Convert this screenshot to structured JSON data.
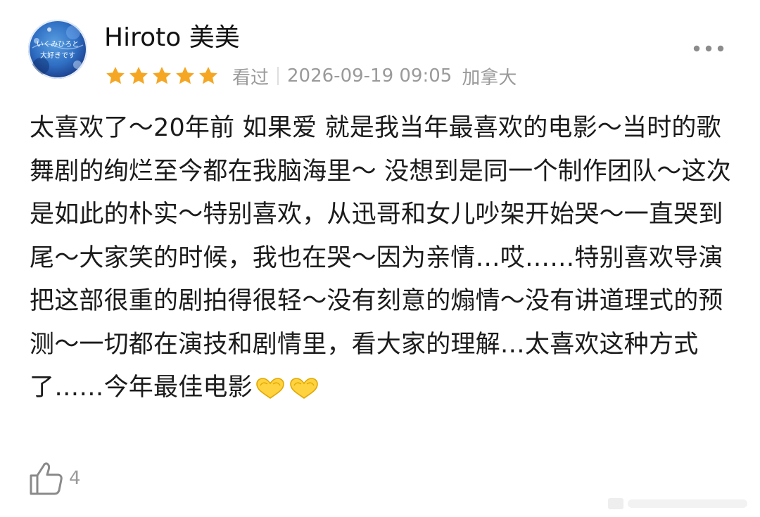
{
  "review": {
    "user": {
      "name": "Hiroto 美美",
      "avatar_text_line1": "いくみひろと",
      "avatar_text_line2": "大好きです"
    },
    "rating": {
      "stars": 5,
      "max_stars": 5,
      "star_color": "#f5a623"
    },
    "status": "看过",
    "datetime": "2026-09-19 09:05",
    "location": "加拿大",
    "text": "太喜欢了～20年前 如果爱 就是我当年最喜欢的电影～当时的歌舞剧的绚烂至今都在我脑海里～ 没想到是同一个制作团队～这次是如此的朴实～特别喜欢，从迅哥和女儿吵架开始哭～一直哭到尾～大家笑的时候，我也在哭～因为亲情…哎……特别喜欢导演把这部很重的剧拍得很轻～没有刻意的煽情～没有讲道理式的预测～一切都在演技和剧情里，看大家的理解…太喜欢这种方式了……今年最佳电影",
    "trailing_emoji": [
      "heart-hands-emoji",
      "heart-hands-emoji"
    ],
    "likes": "4",
    "icons": {
      "more": "more-dots-icon",
      "like": "thumbs-up-icon"
    }
  }
}
